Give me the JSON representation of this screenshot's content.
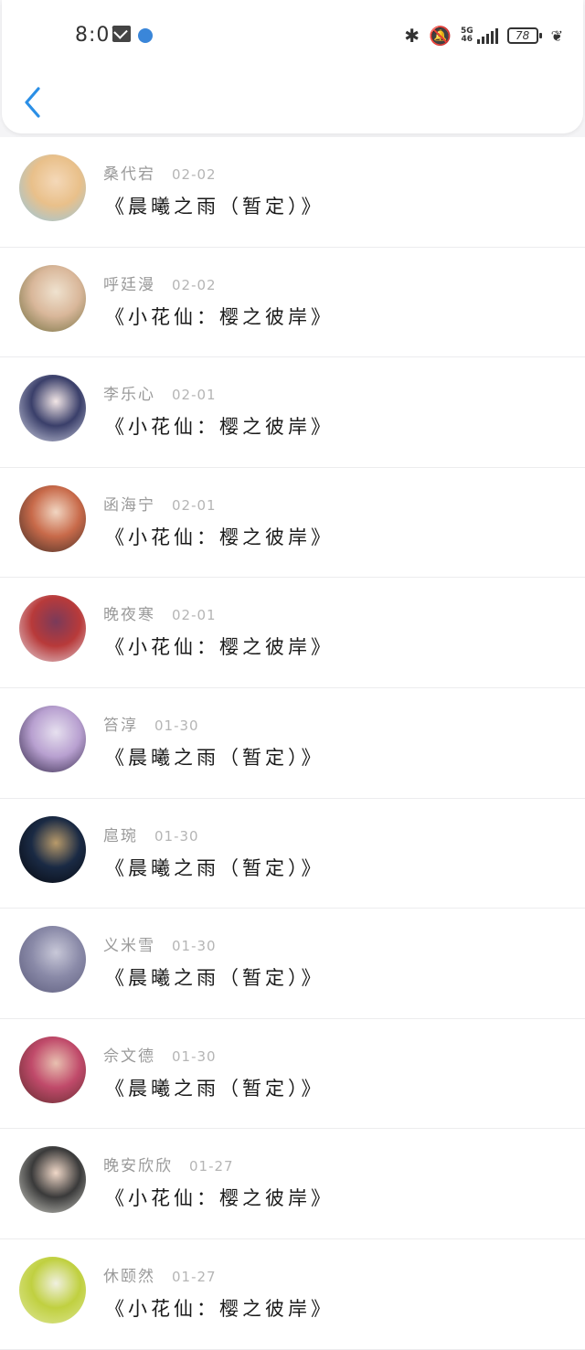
{
  "status_bar": {
    "time": "8:01",
    "network": "5G",
    "network_sub": "46",
    "battery": "78"
  },
  "header": {
    "back_icon": "chevron-left-icon",
    "accent": "#2b8fe6"
  },
  "items": [
    {
      "name": "桑代宕",
      "date": "02-02",
      "message": "《晨曦之雨（暂定）》",
      "avatar_colors": [
        "#8fc8e8",
        "#e9c08a",
        "#f4d8b8"
      ]
    },
    {
      "name": "呼廷漫",
      "date": "02-02",
      "message": "《小花仙：樱之彼岸》",
      "avatar_colors": [
        "#6b6b3a",
        "#d9b79a",
        "#efe2cf"
      ]
    },
    {
      "name": "李乐心",
      "date": "02-01",
      "message": "《小花仙：樱之彼岸》",
      "avatar_colors": [
        "#d7d9e8",
        "#3a3f6a",
        "#f2e6e6"
      ]
    },
    {
      "name": "函海宁",
      "date": "02-01",
      "message": "《小花仙：樱之彼岸》",
      "avatar_colors": [
        "#3a2a24",
        "#c86a4a",
        "#f1d6c2"
      ]
    },
    {
      "name": "晚夜寒",
      "date": "02-01",
      "message": "《小花仙：樱之彼岸》",
      "avatar_colors": [
        "#e6dde3",
        "#b83a3a",
        "#7a3a5a"
      ]
    },
    {
      "name": "笞淳",
      "date": "01-30",
      "message": "《晨曦之雨（暂定）》",
      "avatar_colors": [
        "#2a2040",
        "#b8a0d0",
        "#e6e0ef"
      ]
    },
    {
      "name": "扈琬",
      "date": "01-30",
      "message": "《晨曦之雨（暂定）》",
      "avatar_colors": [
        "#05070c",
        "#1a2a44",
        "#b89a6a"
      ]
    },
    {
      "name": "义米雪",
      "date": "01-30",
      "message": "《晨曦之雨（暂定）》",
      "avatar_colors": [
        "#5a5a7a",
        "#8a8aa8",
        "#c8c8d8"
      ]
    },
    {
      "name": "佘文德",
      "date": "01-30",
      "message": "《晨曦之雨（暂定）》",
      "avatar_colors": [
        "#5a2a2a",
        "#c04a6a",
        "#e8c0b0"
      ]
    },
    {
      "name": "晚安欣欣",
      "date": "01-27",
      "message": "《小花仙：樱之彼岸》",
      "avatar_colors": [
        "#d8d8d0",
        "#3a3a3a",
        "#f0d8c8"
      ]
    },
    {
      "name": "休颐然",
      "date": "01-27",
      "message": "《小花仙：樱之彼岸》",
      "avatar_colors": [
        "#e0e8a0",
        "#c0d040",
        "#f0f0e0"
      ]
    }
  ]
}
